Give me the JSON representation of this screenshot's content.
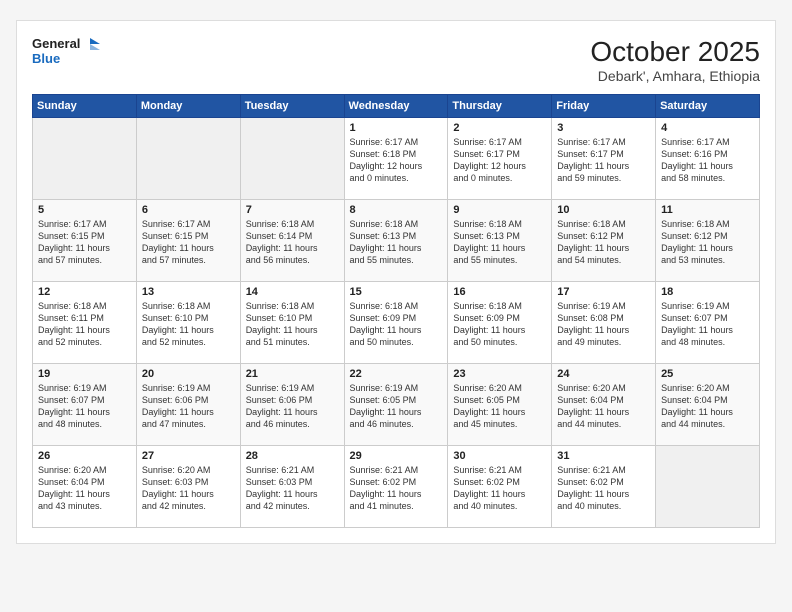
{
  "logo": {
    "line1": "General",
    "line2": "Blue"
  },
  "title": "October 2025",
  "location": "Debark', Amhara, Ethiopia",
  "weekdays": [
    "Sunday",
    "Monday",
    "Tuesday",
    "Wednesday",
    "Thursday",
    "Friday",
    "Saturday"
  ],
  "weeks": [
    [
      {
        "day": "",
        "info": ""
      },
      {
        "day": "",
        "info": ""
      },
      {
        "day": "",
        "info": ""
      },
      {
        "day": "1",
        "info": "Sunrise: 6:17 AM\nSunset: 6:18 PM\nDaylight: 12 hours\nand 0 minutes."
      },
      {
        "day": "2",
        "info": "Sunrise: 6:17 AM\nSunset: 6:17 PM\nDaylight: 12 hours\nand 0 minutes."
      },
      {
        "day": "3",
        "info": "Sunrise: 6:17 AM\nSunset: 6:17 PM\nDaylight: 11 hours\nand 59 minutes."
      },
      {
        "day": "4",
        "info": "Sunrise: 6:17 AM\nSunset: 6:16 PM\nDaylight: 11 hours\nand 58 minutes."
      }
    ],
    [
      {
        "day": "5",
        "info": "Sunrise: 6:17 AM\nSunset: 6:15 PM\nDaylight: 11 hours\nand 57 minutes."
      },
      {
        "day": "6",
        "info": "Sunrise: 6:17 AM\nSunset: 6:15 PM\nDaylight: 11 hours\nand 57 minutes."
      },
      {
        "day": "7",
        "info": "Sunrise: 6:18 AM\nSunset: 6:14 PM\nDaylight: 11 hours\nand 56 minutes."
      },
      {
        "day": "8",
        "info": "Sunrise: 6:18 AM\nSunset: 6:13 PM\nDaylight: 11 hours\nand 55 minutes."
      },
      {
        "day": "9",
        "info": "Sunrise: 6:18 AM\nSunset: 6:13 PM\nDaylight: 11 hours\nand 55 minutes."
      },
      {
        "day": "10",
        "info": "Sunrise: 6:18 AM\nSunset: 6:12 PM\nDaylight: 11 hours\nand 54 minutes."
      },
      {
        "day": "11",
        "info": "Sunrise: 6:18 AM\nSunset: 6:12 PM\nDaylight: 11 hours\nand 53 minutes."
      }
    ],
    [
      {
        "day": "12",
        "info": "Sunrise: 6:18 AM\nSunset: 6:11 PM\nDaylight: 11 hours\nand 52 minutes."
      },
      {
        "day": "13",
        "info": "Sunrise: 6:18 AM\nSunset: 6:10 PM\nDaylight: 11 hours\nand 52 minutes."
      },
      {
        "day": "14",
        "info": "Sunrise: 6:18 AM\nSunset: 6:10 PM\nDaylight: 11 hours\nand 51 minutes."
      },
      {
        "day": "15",
        "info": "Sunrise: 6:18 AM\nSunset: 6:09 PM\nDaylight: 11 hours\nand 50 minutes."
      },
      {
        "day": "16",
        "info": "Sunrise: 6:18 AM\nSunset: 6:09 PM\nDaylight: 11 hours\nand 50 minutes."
      },
      {
        "day": "17",
        "info": "Sunrise: 6:19 AM\nSunset: 6:08 PM\nDaylight: 11 hours\nand 49 minutes."
      },
      {
        "day": "18",
        "info": "Sunrise: 6:19 AM\nSunset: 6:07 PM\nDaylight: 11 hours\nand 48 minutes."
      }
    ],
    [
      {
        "day": "19",
        "info": "Sunrise: 6:19 AM\nSunset: 6:07 PM\nDaylight: 11 hours\nand 48 minutes."
      },
      {
        "day": "20",
        "info": "Sunrise: 6:19 AM\nSunset: 6:06 PM\nDaylight: 11 hours\nand 47 minutes."
      },
      {
        "day": "21",
        "info": "Sunrise: 6:19 AM\nSunset: 6:06 PM\nDaylight: 11 hours\nand 46 minutes."
      },
      {
        "day": "22",
        "info": "Sunrise: 6:19 AM\nSunset: 6:05 PM\nDaylight: 11 hours\nand 46 minutes."
      },
      {
        "day": "23",
        "info": "Sunrise: 6:20 AM\nSunset: 6:05 PM\nDaylight: 11 hours\nand 45 minutes."
      },
      {
        "day": "24",
        "info": "Sunrise: 6:20 AM\nSunset: 6:04 PM\nDaylight: 11 hours\nand 44 minutes."
      },
      {
        "day": "25",
        "info": "Sunrise: 6:20 AM\nSunset: 6:04 PM\nDaylight: 11 hours\nand 44 minutes."
      }
    ],
    [
      {
        "day": "26",
        "info": "Sunrise: 6:20 AM\nSunset: 6:04 PM\nDaylight: 11 hours\nand 43 minutes."
      },
      {
        "day": "27",
        "info": "Sunrise: 6:20 AM\nSunset: 6:03 PM\nDaylight: 11 hours\nand 42 minutes."
      },
      {
        "day": "28",
        "info": "Sunrise: 6:21 AM\nSunset: 6:03 PM\nDaylight: 11 hours\nand 42 minutes."
      },
      {
        "day": "29",
        "info": "Sunrise: 6:21 AM\nSunset: 6:02 PM\nDaylight: 11 hours\nand 41 minutes."
      },
      {
        "day": "30",
        "info": "Sunrise: 6:21 AM\nSunset: 6:02 PM\nDaylight: 11 hours\nand 40 minutes."
      },
      {
        "day": "31",
        "info": "Sunrise: 6:21 AM\nSunset: 6:02 PM\nDaylight: 11 hours\nand 40 minutes."
      },
      {
        "day": "",
        "info": ""
      }
    ]
  ]
}
